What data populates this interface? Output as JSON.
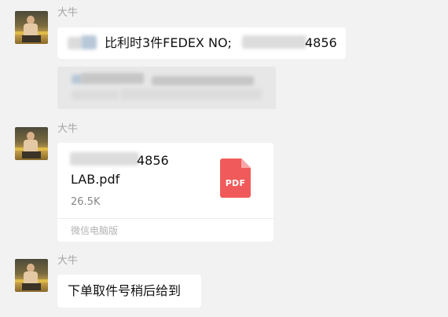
{
  "messages": [
    {
      "sender": "大牛",
      "text_visible_start": "比利时3件FEDEX NO;",
      "text_visible_end": "4856"
    },
    {
      "sender": "大牛",
      "file": {
        "name_line1_end": "4856",
        "name_line2": "LAB.pdf",
        "size": "26.5K",
        "source": "微信电脑版",
        "icon_label": "PDF",
        "icon_color": "#f15a5a"
      }
    },
    {
      "sender": "大牛",
      "text": "下单取件号稍后给到"
    }
  ]
}
